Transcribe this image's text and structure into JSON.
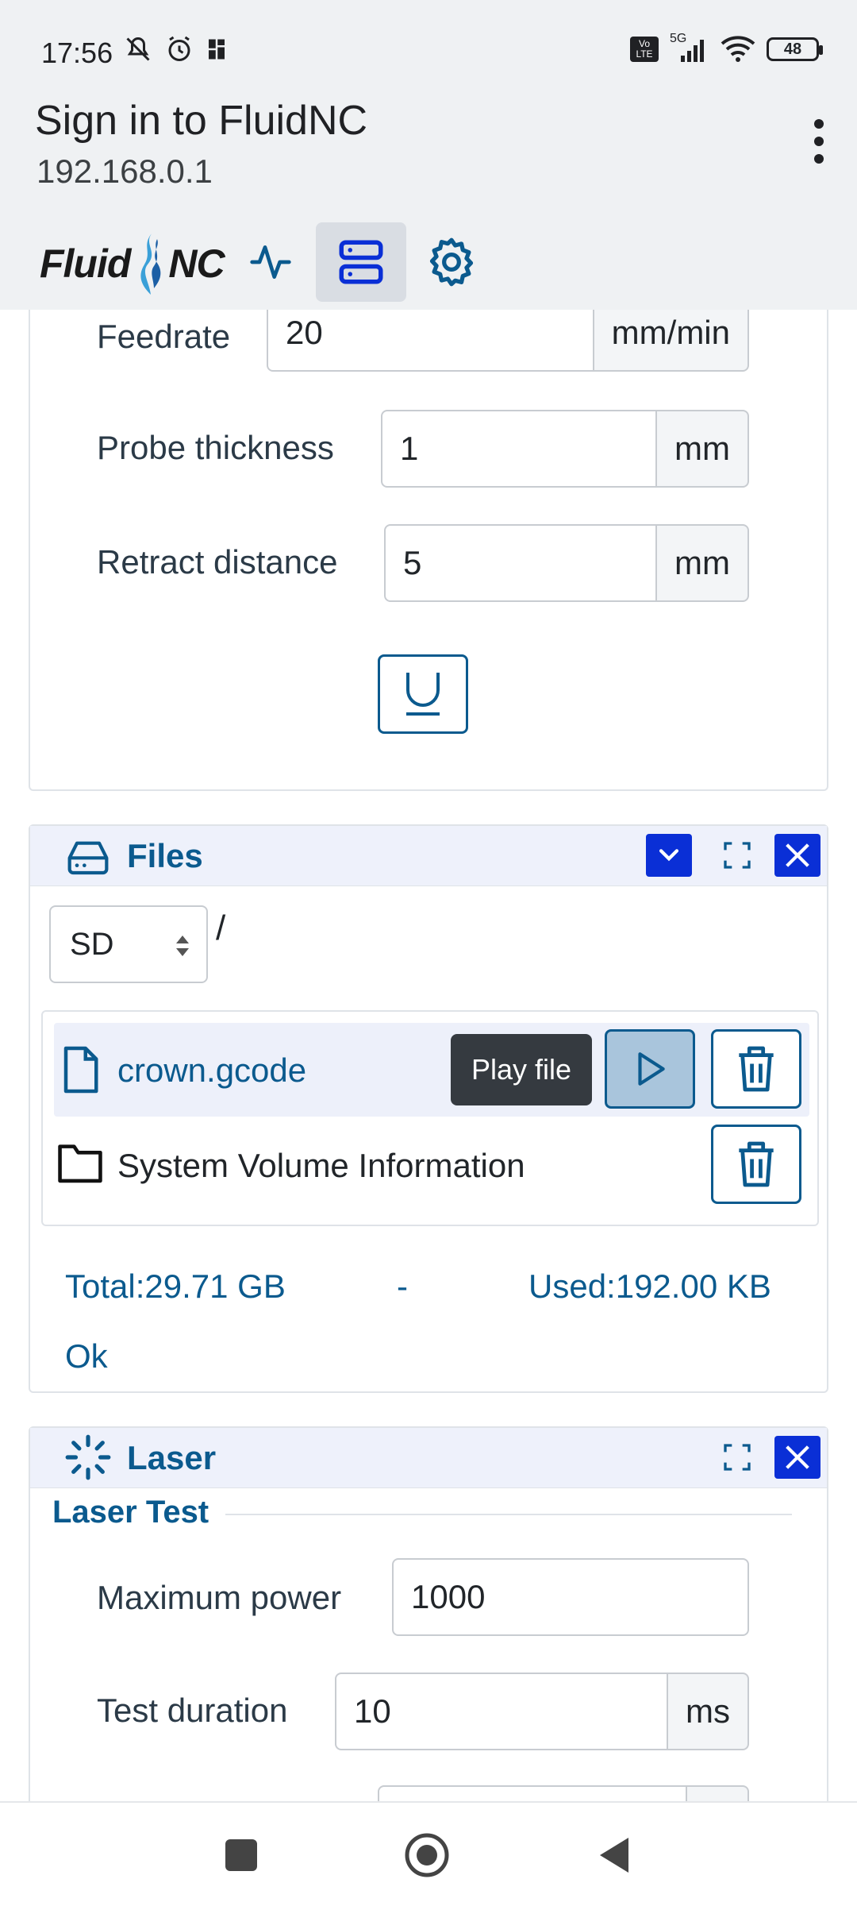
{
  "status": {
    "time": "17:56",
    "battery": "48",
    "network": "5G",
    "volte": "Vo LTE"
  },
  "browser": {
    "title": "Sign in to FluidNC",
    "url": "192.168.0.1"
  },
  "app": {
    "logo_left": "Fluid",
    "logo_right": "NC"
  },
  "probe": {
    "feedrate_label": "Feedrate",
    "feedrate_value": "20",
    "feedrate_unit": "mm/min",
    "thickness_label": "Probe thickness",
    "thickness_value": "1",
    "thickness_unit": "mm",
    "retract_label": "Retract distance",
    "retract_value": "5",
    "retract_unit": "mm"
  },
  "files": {
    "title": "Files",
    "source": "SD",
    "path": "/",
    "items": [
      {
        "name": "crown.gcode",
        "type": "file"
      },
      {
        "name": "System Volume Information",
        "type": "folder"
      }
    ],
    "tooltip": "Play file",
    "total": "Total:29.71 GB",
    "separator": "-",
    "used": "Used:192.00 KB",
    "status": "Ok"
  },
  "laser": {
    "title": "Laser",
    "section": "Laser Test",
    "max_power_label": "Maximum power",
    "max_power_value": "1000",
    "duration_label": "Test duration",
    "duration_value": "10",
    "duration_unit": "ms"
  },
  "colors": {
    "accent": "#0b5a8e",
    "close_button": "#0a2fd6"
  }
}
